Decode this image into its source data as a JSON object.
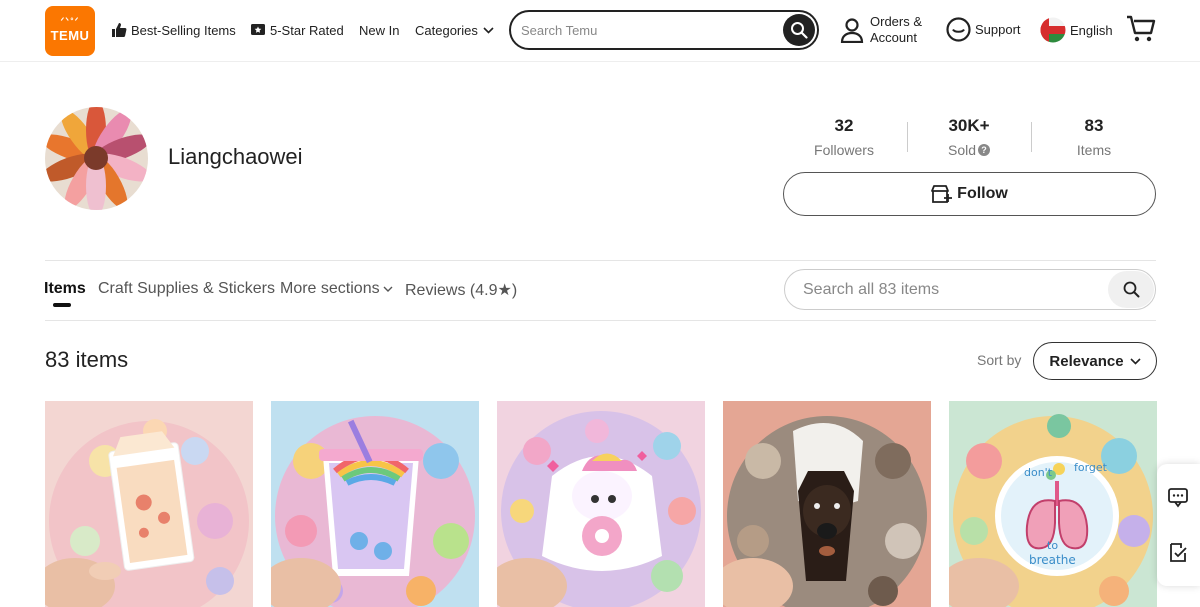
{
  "header": {
    "logo_glyphs": "ᐟᐠᐤᐟ",
    "logo_text": "TEMU",
    "nav": [
      {
        "label": "Best-Selling Items",
        "icon": "thumbs-up-icon"
      },
      {
        "label": "5-Star Rated",
        "icon": "star-badge-icon"
      },
      {
        "label": "New In"
      },
      {
        "label": "Categories",
        "icon": "chevron-down-icon"
      }
    ],
    "search_placeholder": "Search Temu",
    "orders_line1": "Orders &",
    "orders_line2": "Account",
    "support_label": "Support",
    "language_label": "English",
    "colors": {
      "brand": "#fb7701",
      "text": "#222222"
    }
  },
  "store": {
    "name": "Liangchaowei",
    "stats": [
      {
        "value": "32",
        "label": "Followers"
      },
      {
        "value": "30K+",
        "label": "Sold",
        "has_info": true
      },
      {
        "value": "83",
        "label": "Items"
      }
    ],
    "info_mark": "?",
    "follow_label": "Follow"
  },
  "tabs": {
    "items": "Items",
    "craft": "Craft Supplies & Stickers",
    "more": "More sections",
    "reviews": "Reviews (4.9★)"
  },
  "store_search_placeholder": "Search all 83 items",
  "listing": {
    "count_text": "83 items",
    "sort_label": "Sort by",
    "sort_value": "Relevance"
  },
  "products": [
    {
      "subject": "strawberry-milk-sticker",
      "bg": "#f4c9c9"
    },
    {
      "subject": "rainbow-bubble-tea-sticker",
      "bg": "#a7d3ea"
    },
    {
      "subject": "unicorn-donut-sticker",
      "bg": "#eec0d2"
    },
    {
      "subject": "dachshund-towel-sticker",
      "bg": "#e7a99a"
    },
    {
      "subject": "lungs-breathe-sticker",
      "bg": "#c5e3cc",
      "sticker_text_1": "don't",
      "sticker_text_2": "forget",
      "sticker_text_3": "to",
      "sticker_text_4": "breathe"
    }
  ],
  "side_panel": [
    "chat-icon",
    "edit-note-icon"
  ]
}
